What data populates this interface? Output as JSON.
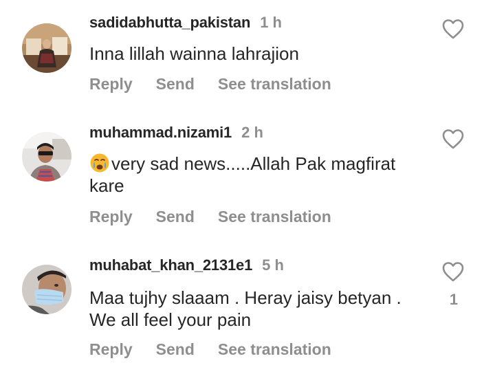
{
  "comments": [
    {
      "username": "sadidabhutta_pakistan",
      "time": "1 h",
      "text": "Inna lillah wainna lahrajion",
      "actions": {
        "reply": "Reply",
        "send": "Send",
        "translate": "See translation"
      },
      "likes": ""
    },
    {
      "username": "muhammad.nizami1",
      "time": "2 h",
      "text": "very sad news.....Allah Pak magfirat kare",
      "emoji": "crying-face-icon",
      "actions": {
        "reply": "Reply",
        "send": "Send",
        "translate": "See translation"
      },
      "likes": ""
    },
    {
      "username": "muhabat_khan_2131e1",
      "time": "5 h",
      "text": "Maa tujhy slaaam . Heray jaisy betyan . We all feel your pain",
      "actions": {
        "reply": "Reply",
        "send": "Send",
        "translate": "See translation"
      },
      "likes": "1"
    }
  ],
  "colors": {
    "text": "#262626",
    "secondary": "#8e8e8e",
    "heart_stroke": "#8e8e8e"
  }
}
